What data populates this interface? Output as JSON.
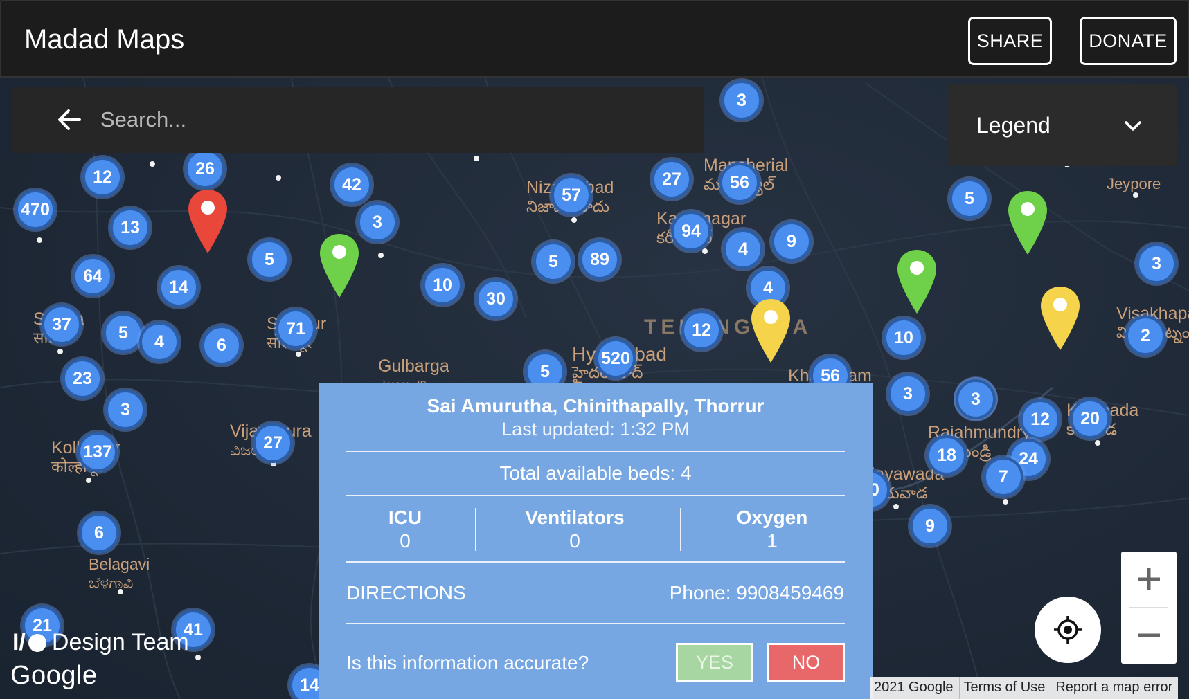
{
  "app": {
    "title": "Madad Maps"
  },
  "header": {
    "share_label": "SHARE",
    "donate_label": "DONATE"
  },
  "search": {
    "placeholder": "Search..."
  },
  "legend": {
    "label": "Legend"
  },
  "map": {
    "cities": [
      {
        "name": "Mancherial",
        "native": "మంచిర్యాల్"
      },
      {
        "name": "Jeypore",
        "native": ""
      },
      {
        "name": "Nizamabad",
        "native": "నిజామాబాదు"
      },
      {
        "name": "Karimnagar",
        "native": "కరీంనగర్"
      },
      {
        "name": "Hyderabad",
        "native": "హైదరాబాద్"
      },
      {
        "name": "Gulbarga",
        "native": "ಕಲಬುರಗಿ"
      },
      {
        "name": "Vijayapura",
        "native": "ವಿಜಯಪುರ"
      },
      {
        "name": "Kolhapur",
        "native": "कोल्हापूर"
      },
      {
        "name": "Belagavi",
        "native": "ಬೆಳಗಾವಿ"
      },
      {
        "name": "Khammam",
        "native": ""
      },
      {
        "name": "Rajahmundry",
        "native": "రాజమండ్రి"
      },
      {
        "name": "Kakinada",
        "native": "కాకినాడ"
      },
      {
        "name": "Visakhapatnam",
        "native": "విశాఖపట్నం"
      },
      {
        "name": "Vijayawada",
        "native": "విజయవాడ"
      },
      {
        "name": "Solapur",
        "native": "सोलापूर"
      },
      {
        "name": "Satara",
        "native": "सातारा"
      }
    ],
    "region_label": "TELANGANA",
    "clusters": [
      "470",
      "12",
      "26",
      "13",
      "64",
      "14",
      "5",
      "42",
      "3",
      "37",
      "5",
      "4",
      "6",
      "71",
      "23",
      "3",
      "137",
      "27",
      "6",
      "21",
      "41",
      "14",
      "10",
      "30",
      "5",
      "89",
      "57",
      "27",
      "56",
      "94",
      "4",
      "9",
      "4",
      "12",
      "520",
      "5",
      "56",
      "3",
      "10",
      "3",
      "3",
      "5",
      "3",
      "2",
      "3",
      "12",
      "20",
      "18",
      "24",
      "7",
      "9",
      "30"
    ]
  },
  "popup": {
    "name": "Sai Amurutha, Chinithapally, Thorrur",
    "updated": "Last updated: 1:32 PM",
    "total_beds": "Total available beds: 4",
    "icu_label": "ICU",
    "icu_value": "0",
    "ventilators_label": "Ventilators",
    "ventilators_value": "0",
    "oxygen_label": "Oxygen",
    "oxygen_value": "1",
    "directions_label": "DIRECTIONS",
    "phone": "Phone: 9908459469",
    "question": "Is this information accurate?",
    "yes_label": "YES",
    "no_label": "NO"
  },
  "controls": {
    "zoom_in": "+",
    "zoom_out": "−"
  },
  "branding": {
    "io_mark": "I/O",
    "team": "Design Team",
    "google": "Google"
  },
  "attribution": {
    "copyright": "2021 Google",
    "terms": "Terms of Use",
    "report": "Report a map error"
  },
  "colors": {
    "cluster": "#4a8ef0",
    "popup_bg": "#77a7e2",
    "pin_green": "#6fd14a",
    "pin_red": "#e8473a",
    "pin_yellow": "#f5d34a"
  }
}
